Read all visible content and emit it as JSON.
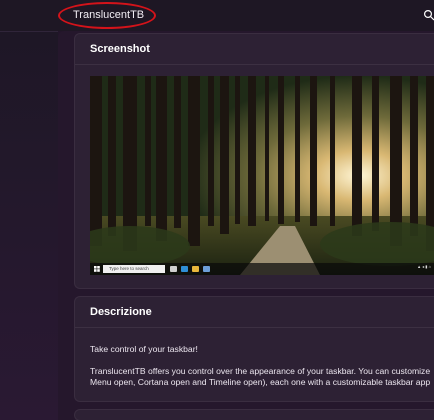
{
  "header": {
    "title": "TranslucentTB",
    "search_icon": "search-icon"
  },
  "screenshot_card": {
    "title": "Screenshot",
    "taskbar": {
      "search_placeholder": "Type here to search"
    }
  },
  "description_card": {
    "title": "Descrizione",
    "paragraph_1": "Take control of your taskbar!",
    "paragraph_2_line_1": "TranslucentTB offers you control over the appearance of your taskbar. You can customize",
    "paragraph_2_line_2": "Menu open, Cortana open and Timeline open), each one with a customizable taskbar app"
  },
  "colors": {
    "highlight": "#d4131a",
    "background": "#22152a",
    "card": "#2d2134"
  }
}
